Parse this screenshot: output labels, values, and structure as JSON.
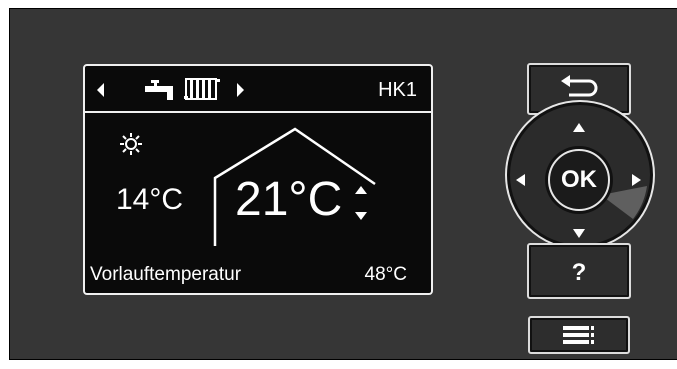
{
  "display": {
    "circuit": "HK1",
    "outside_temp": "14°C",
    "set_temp": "21°C",
    "info_label": "Vorlauftemperatur",
    "info_value": "48°C"
  },
  "controls": {
    "ok_label": "OK",
    "help_label": "?"
  },
  "icons": {
    "back": "return-arrow-icon",
    "menu": "menu-icon",
    "sun": "sun-icon",
    "tap": "tap-icon",
    "radiator": "radiator-icon"
  }
}
